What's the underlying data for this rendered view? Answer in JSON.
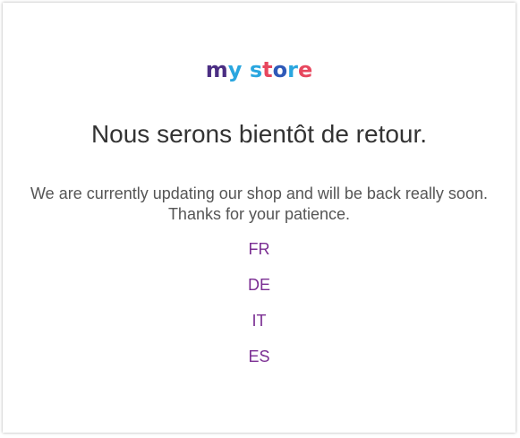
{
  "logo": {
    "letters": [
      {
        "char": "m",
        "color": "#4b2e83"
      },
      {
        "char": "y",
        "color": "#2aa6df"
      },
      {
        "char": " ",
        "color": "#ffffff"
      },
      {
        "char": "s",
        "color": "#2aa6df"
      },
      {
        "char": "t",
        "color": "#e7475e"
      },
      {
        "char": "o",
        "color": "#2e59b8"
      },
      {
        "char": "r",
        "color": "#2aa6df"
      },
      {
        "char": "e",
        "color": "#e7475e"
      }
    ]
  },
  "title": "Nous serons bientôt de retour.",
  "message": {
    "line1": "We are currently updating our shop and will be back really soon.",
    "line2": "Thanks for your patience."
  },
  "languages": [
    "FR",
    "DE",
    "IT",
    "ES"
  ],
  "colors": {
    "link": "#7a2d92",
    "title": "#333333",
    "text": "#555555"
  }
}
